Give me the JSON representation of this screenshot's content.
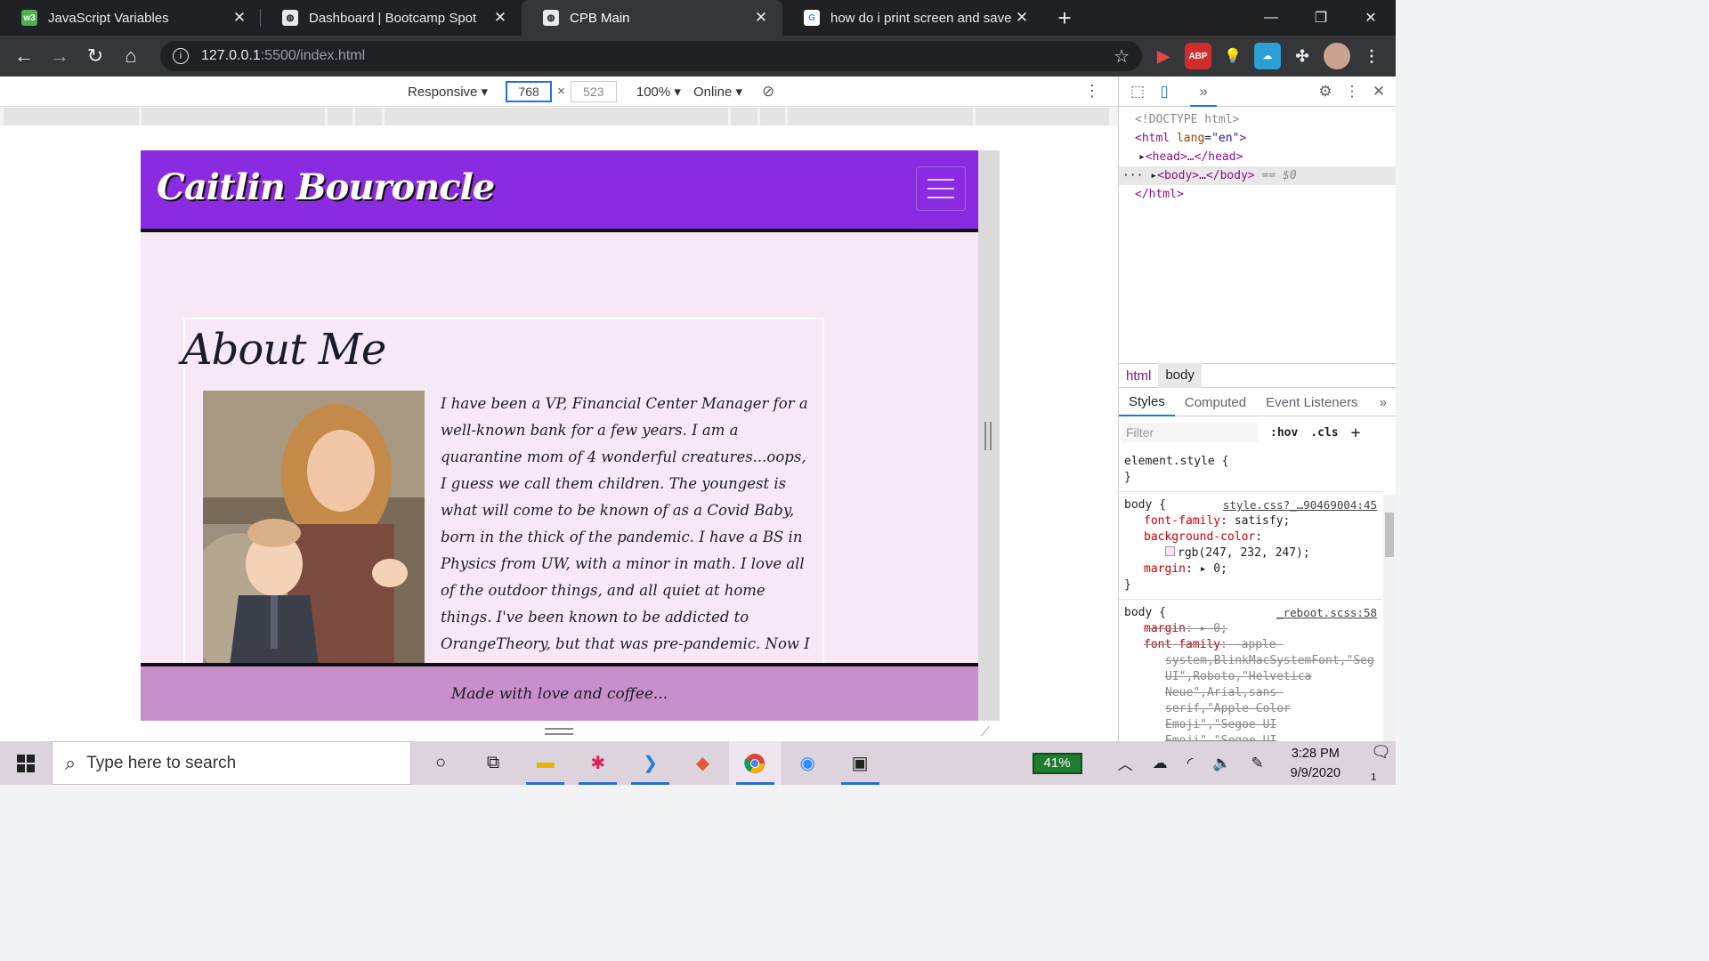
{
  "browser": {
    "tabs": [
      {
        "title": "JavaScript Variables",
        "favicon": "w3schools-icon",
        "active": false
      },
      {
        "title": "Dashboard | Bootcamp Spot",
        "favicon": "globe-icon",
        "active": false
      },
      {
        "title": "CPB Main",
        "favicon": "globe-icon",
        "active": true
      },
      {
        "title": "how do i print screen and save to",
        "favicon": "google-icon",
        "active": false
      }
    ],
    "url_host": "127.0.0.1",
    "url_path": ":5500/index.html",
    "extensions": [
      {
        "name": "video-extension-icon",
        "label": "",
        "color": "#e04848"
      },
      {
        "name": "adblock-plus-icon",
        "label": "ABP",
        "color": "#d22d2d"
      },
      {
        "name": "lightbulb-extension-icon",
        "label": "",
        "color": "#5f6368"
      },
      {
        "name": "cloud-extension-icon",
        "label": "",
        "color": "#2b9fd6"
      },
      {
        "name": "extensions-puzzle-icon",
        "label": "",
        "color": "#5f6368"
      }
    ]
  },
  "device_toolbar": {
    "mode": "Responsive",
    "width": "768",
    "height": "523",
    "zoom": "100%",
    "network": "Online"
  },
  "site": {
    "brand": "Caitlin Bouroncle",
    "about_title": "About Me",
    "about_text": "I have been a VP, Financial Center Manager for a well-known bank for a few years. I am a quarantine mom of 4 wonderful creatures...oops, I guess we call them children. The youngest is what will come to be known of as a Covid Baby, born in the thick of the pandemic. I have a BS in Physics from UW, with a minor in math. I love all of the outdoor things, and all quiet at home things. I've been known to be addicted to OrangeTheory, but that was pre-pandemic. Now I get my excercise chasing children and going on",
    "footer": "Made with love and coffee...",
    "colors": {
      "navbar": "#8a2be2",
      "page_bg": "#f7e8f7",
      "footer": "#c88fcb"
    }
  },
  "devtools": {
    "dom": {
      "doctype": "<!DOCTYPE html>",
      "html_open_tag": "html",
      "html_attr": "lang",
      "html_attr_value": "\"en\"",
      "head": "head",
      "body": "body",
      "selected_suffix": "== $0",
      "html_close": "</html>"
    },
    "breadcrumbs": [
      "html",
      "body"
    ],
    "panel_tabs": [
      "Styles",
      "Computed",
      "Event Listeners"
    ],
    "filter_placeholder": "Filter",
    "hov": ":hov",
    "cls": ".cls",
    "element_style": "element.style {",
    "rule1": {
      "selector": "body {",
      "source": "style.css?_…90469004:45",
      "p1": "font-family",
      "v1": "satisfy;",
      "p2": "background-color",
      "v2": "rgb(247, 232, 247);",
      "p3": "margin",
      "v3": "0;"
    },
    "rule2": {
      "selector": "body {",
      "source": "_reboot.scss:58",
      "p1": "margin",
      "v1": "0;",
      "p2": "font-family",
      "v2a": "-apple-",
      "v2b": "system,BlinkMacSystemFont,\"Seg",
      "v2c": "UI\",Roboto,\"Helvetica",
      "v2d": "Neue\",Arial,sans-",
      "v2e": "serif,\"Apple Color",
      "v2f": "Emoji\",\"Segoe UI",
      "v2g": "Emoji\",\"Segoe UI"
    }
  },
  "taskbar": {
    "search_placeholder": "Type here to search",
    "battery": "41%",
    "time": "3:28 PM",
    "date": "9/9/2020",
    "notifications": "1"
  }
}
